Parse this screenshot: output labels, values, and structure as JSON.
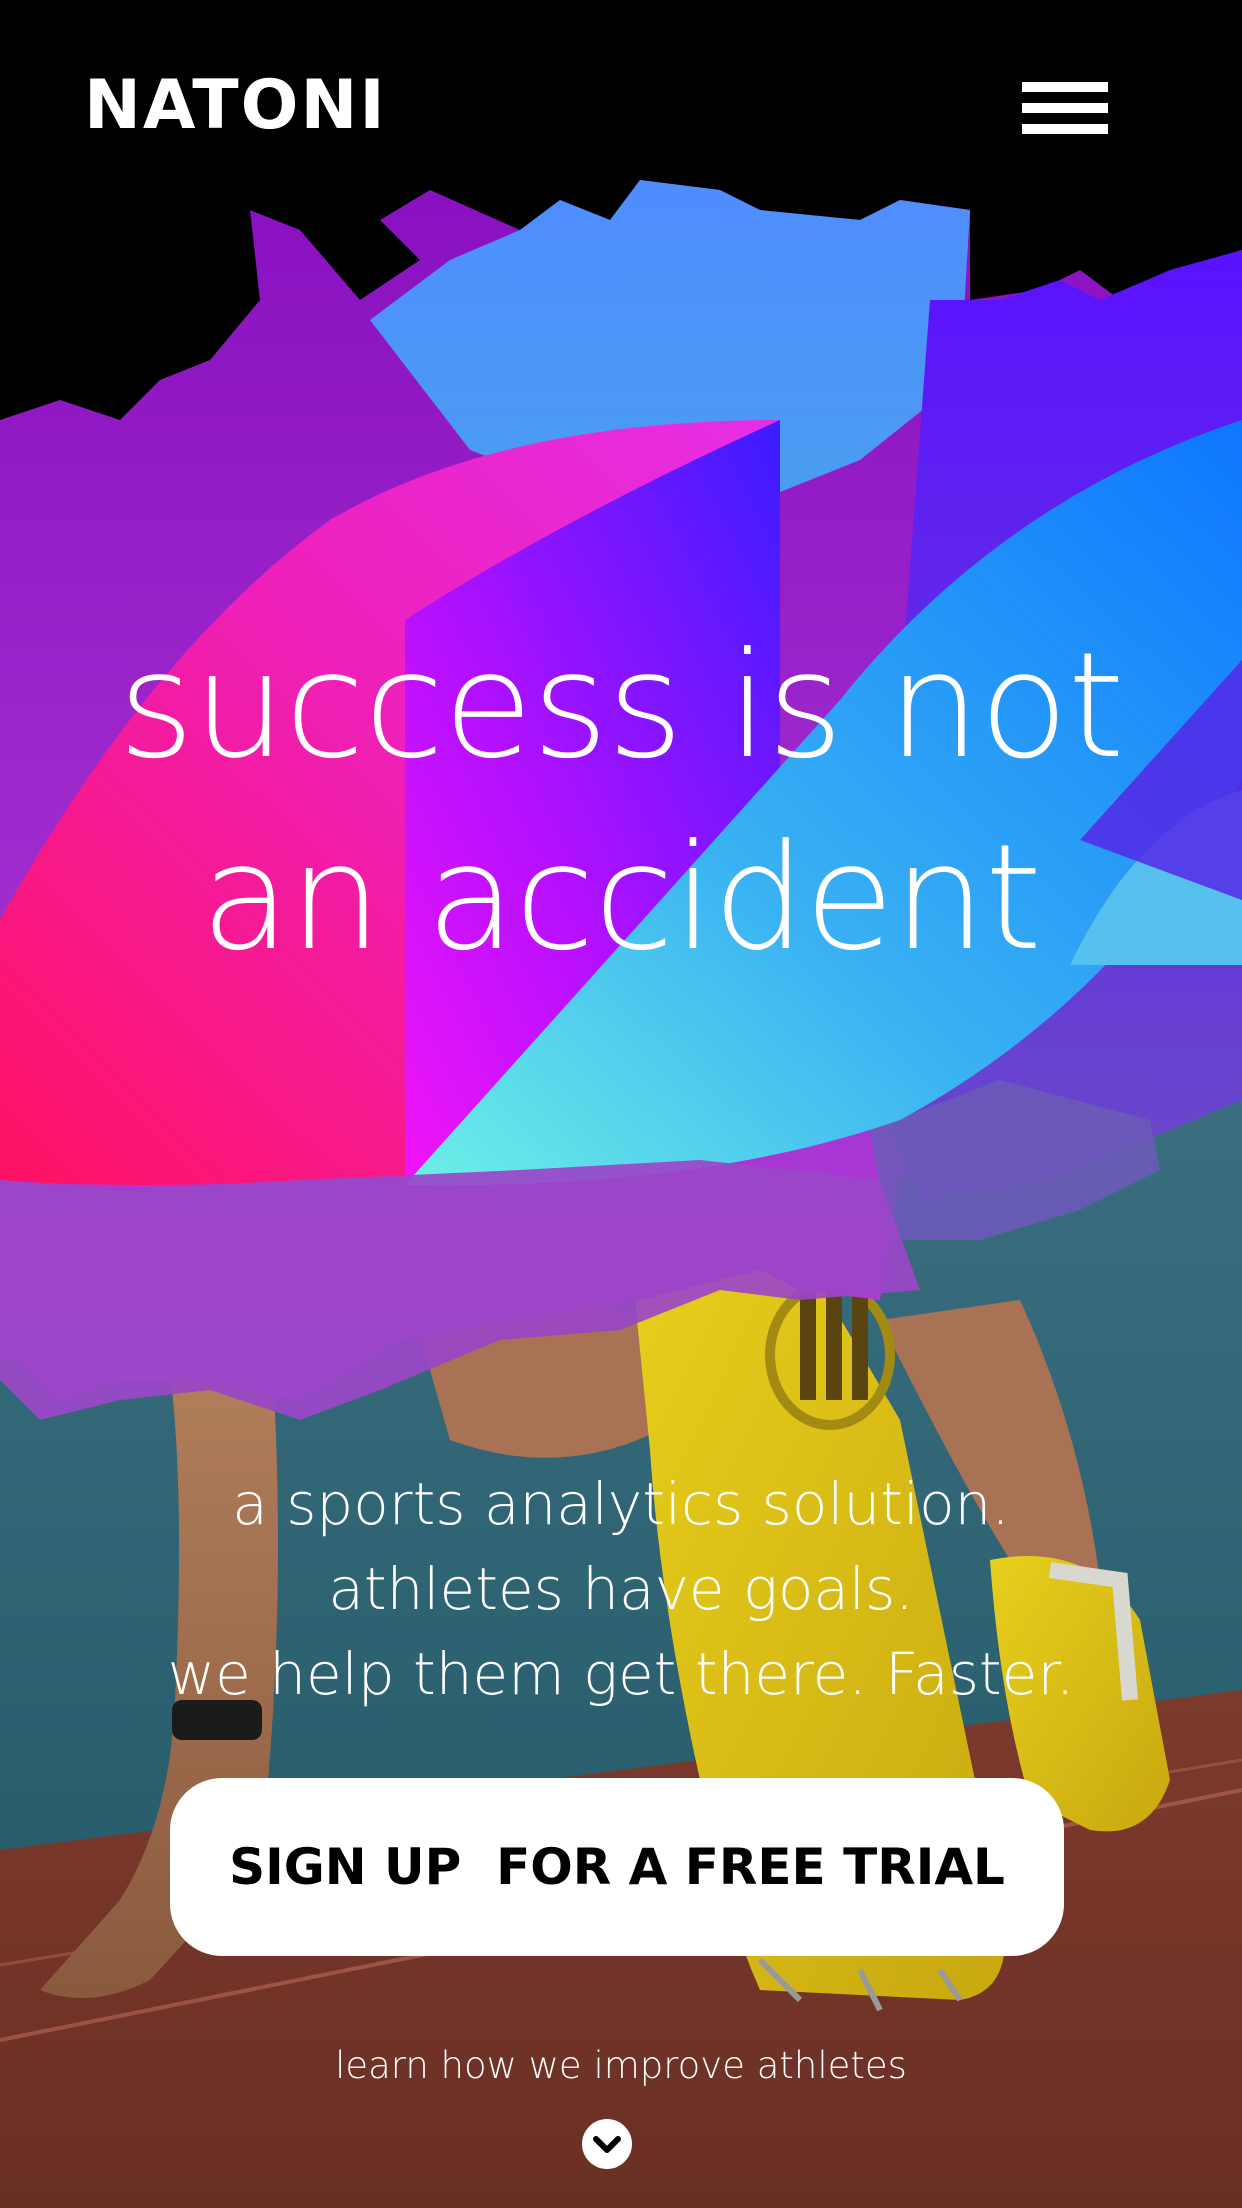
{
  "header": {
    "logo": "NATONI",
    "menu_icon": "hamburger-menu-icon"
  },
  "hero": {
    "headline_line1": "success is not",
    "headline_line2": "an accident",
    "sub_line1": "a sports analytics solution.",
    "sub_line2": "athletes have goals.",
    "sub_line3": "we help them get there. Faster."
  },
  "cta": {
    "label": "SIGN UP  FOR A FREE TRIAL"
  },
  "footer": {
    "learn_more": "learn how we improve athletes",
    "scroll_icon": "chevron-down-icon"
  },
  "colors": {
    "background": "#000000",
    "accent_pink": "#ff1a7a",
    "accent_purple": "#9b00ff",
    "accent_blue": "#1a7dff",
    "accent_cyan": "#5ce5e8",
    "shoe_yellow": "#e6c81a",
    "track_red": "#8c3a2c",
    "button_bg": "#ffffff",
    "text": "#ffffff"
  }
}
